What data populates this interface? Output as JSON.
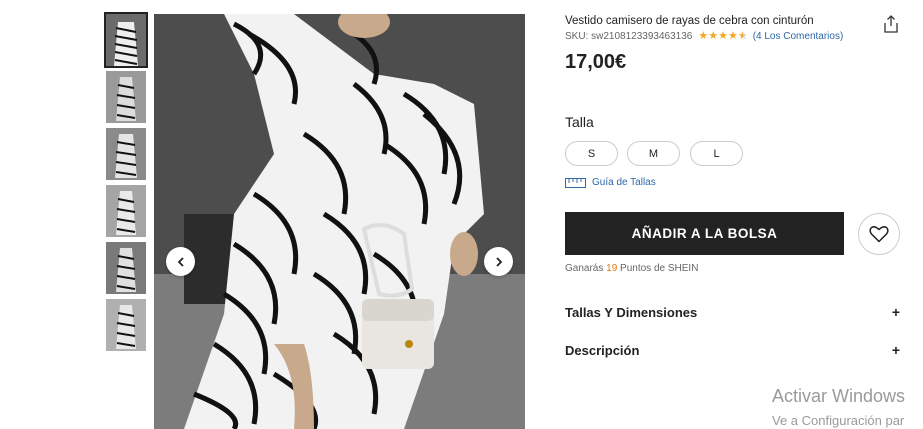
{
  "product": {
    "title": "Vestido camisero de rayas de cebra con cinturón",
    "sku": "SKU: sw2108123393463136",
    "rating": 4.5,
    "reviews": "(4 Los Comentarios)",
    "price": "17,00€"
  },
  "sizes": {
    "label": "Talla",
    "options": [
      "S",
      "M",
      "L"
    ],
    "guide": "Guía de Tallas"
  },
  "actions": {
    "add_to_bag": "AÑADIR A LA BOLSA",
    "points_prefix": "Ganarás",
    "points_value": "19",
    "points_suffix": "Puntos de SHEIN"
  },
  "accordions": {
    "size_dims": "Tallas Y Dimensiones",
    "description": "Descripción",
    "plus": "+"
  },
  "gallery": {
    "thumbnail_count": 6,
    "active_index": 0
  },
  "watermark": {
    "line1": "Activar Windows",
    "line2": "Ve a Configuración par"
  },
  "colors": {
    "accent_star": "#f5a623",
    "link": "#2d68a8",
    "button": "#222222",
    "points": "#e07b1a"
  }
}
